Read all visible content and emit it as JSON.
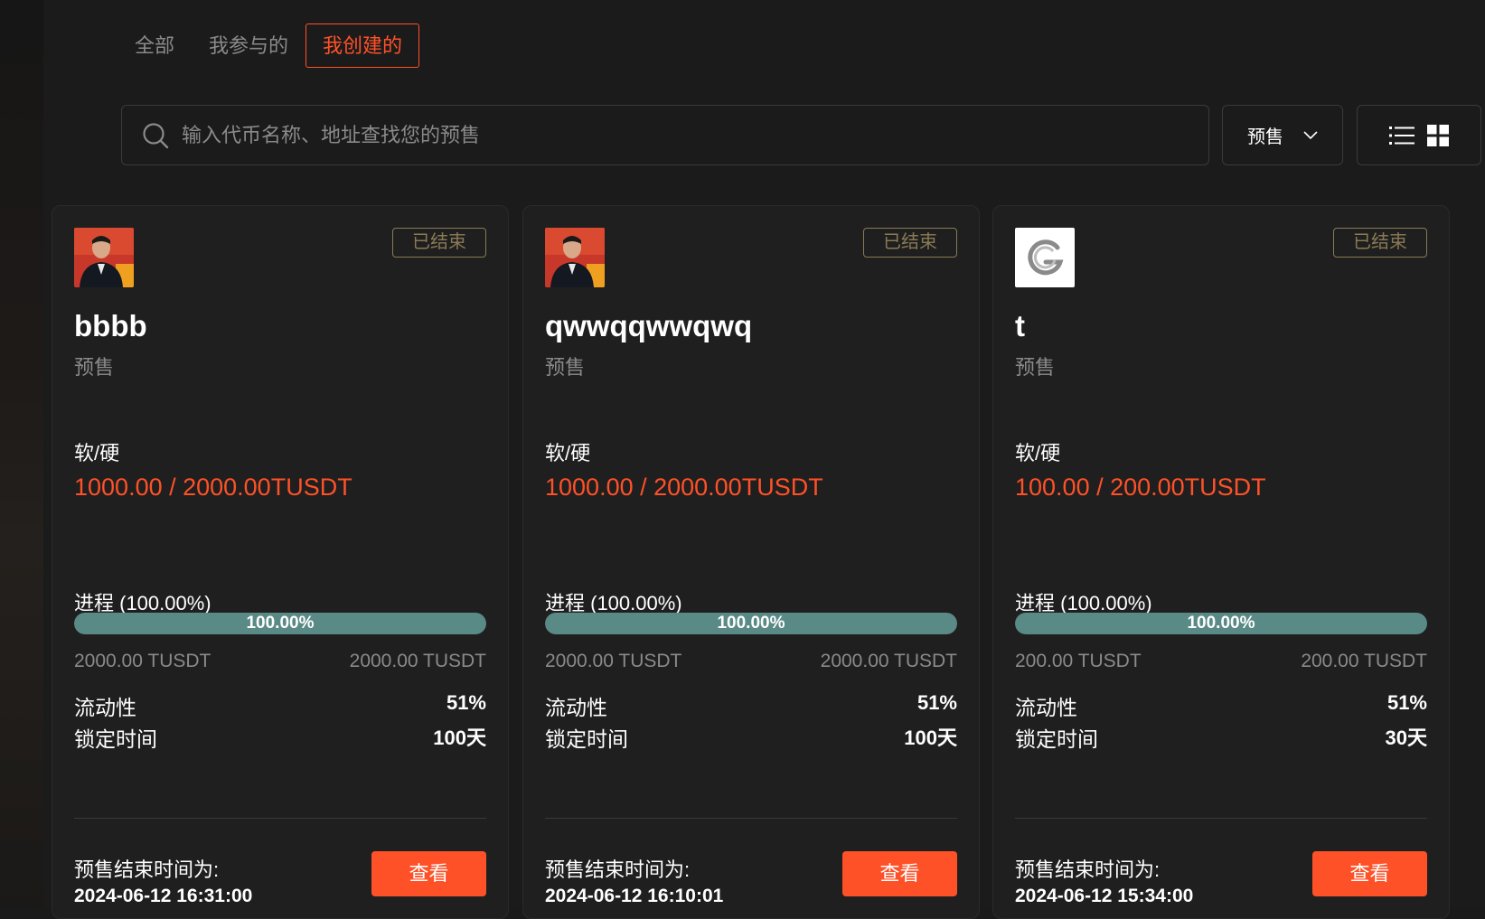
{
  "tabs": [
    {
      "label": "全部",
      "active": false
    },
    {
      "label": "我参与的",
      "active": false
    },
    {
      "label": "我创建的",
      "active": true
    }
  ],
  "search": {
    "placeholder": "输入代币名称、地址查找您的预售",
    "icon": "search-icon"
  },
  "type_filter": {
    "selected": "预售",
    "icon": "chevron-down-icon"
  },
  "view_toggle": {
    "list_icon": "list-icon",
    "grid_icon": "grid-icon",
    "active": "grid"
  },
  "colors": {
    "accent": "#ff5128",
    "progress": "#5a8a86",
    "status_border": "#8a7a55"
  },
  "labels": {
    "cap": "软/硬",
    "liquidity": "流动性",
    "lock_time": "锁定时间",
    "end_time": "预售结束时间为:",
    "view_button": "查看"
  },
  "cards": [
    {
      "avatar": "person-photo",
      "status": "已结束",
      "name": "bbbb",
      "type": "预售",
      "cap_value": "1000.00 / 2000.00TUSDT",
      "progress_label": "进程 (100.00%)",
      "progress": 100,
      "progress_text": "100.00%",
      "raised": "2000.00 TUSDT",
      "hard_cap": "2000.00 TUSDT",
      "liquidity": "51%",
      "lock_time": "100天",
      "end_time": "2024-06-12 16:31:00"
    },
    {
      "avatar": "person-photo",
      "status": "已结束",
      "name": "qwwqqwwqwq",
      "type": "预售",
      "cap_value": "1000.00 / 2000.00TUSDT",
      "progress_label": "进程 (100.00%)",
      "progress": 100,
      "progress_text": "100.00%",
      "raised": "2000.00 TUSDT",
      "hard_cap": "2000.00 TUSDT",
      "liquidity": "51%",
      "lock_time": "100天",
      "end_time": "2024-06-12 16:10:01"
    },
    {
      "avatar": "g-logo",
      "status": "已结束",
      "name": "t",
      "type": "预售",
      "cap_value": "100.00 / 200.00TUSDT",
      "progress_label": "进程 (100.00%)",
      "progress": 100,
      "progress_text": "100.00%",
      "raised": "200.00 TUSDT",
      "hard_cap": "200.00 TUSDT",
      "liquidity": "51%",
      "lock_time": "30天",
      "end_time": "2024-06-12 15:34:00"
    }
  ]
}
